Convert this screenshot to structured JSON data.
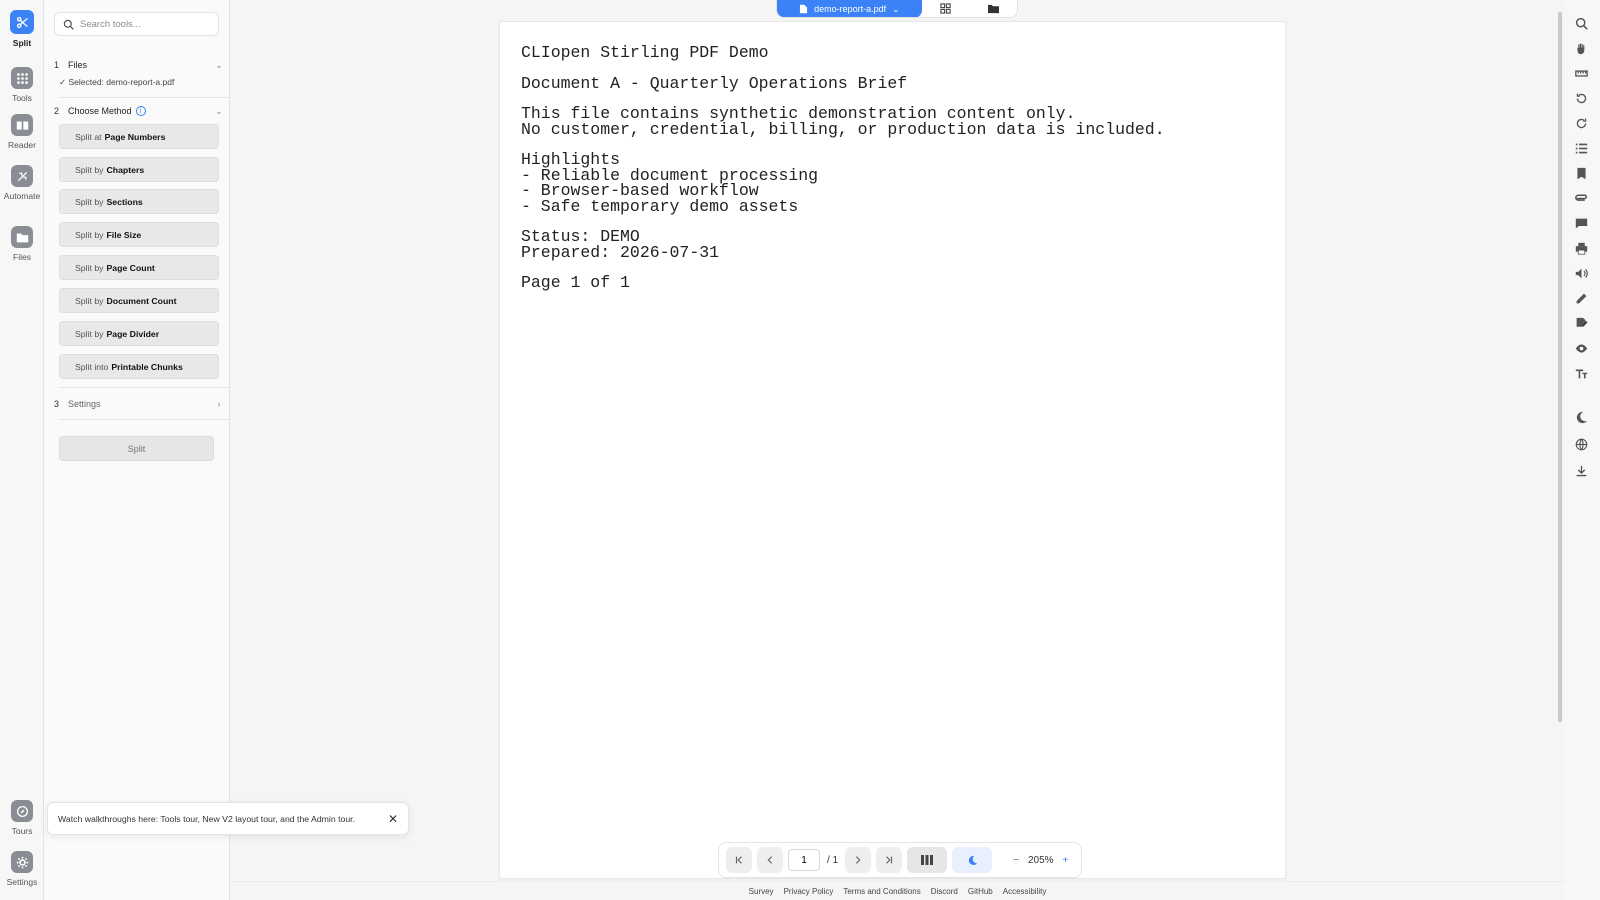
{
  "colors": {
    "accent": "#3b82f6",
    "icon_gray": "#8a8e94"
  },
  "left_rail": {
    "items": [
      {
        "label": "Split",
        "icon": "scissors-icon"
      },
      {
        "label": "Tools",
        "icon": "grid-icon"
      },
      {
        "label": "Reader",
        "icon": "book-icon"
      },
      {
        "label": "Automate",
        "icon": "automate-icon"
      },
      {
        "label": "Files",
        "icon": "folder-icon"
      },
      {
        "label": "Tours",
        "icon": "compass-icon"
      },
      {
        "label": "Settings",
        "icon": "gear-icon"
      }
    ]
  },
  "panel": {
    "search_placeholder": "Search tools...",
    "steps": [
      {
        "num": "1",
        "title": "Files"
      },
      {
        "num": "2",
        "title": "Choose Method"
      },
      {
        "num": "3",
        "title": "Settings"
      }
    ],
    "selected_file": "✓ Selected: demo-report-a.pdf",
    "methods": [
      {
        "prefix": "Split at",
        "bold": "Page Numbers"
      },
      {
        "prefix": "Split by",
        "bold": "Chapters"
      },
      {
        "prefix": "Split by",
        "bold": "Sections"
      },
      {
        "prefix": "Split by",
        "bold": "File Size"
      },
      {
        "prefix": "Split by",
        "bold": "Page Count"
      },
      {
        "prefix": "Split by",
        "bold": "Document Count"
      },
      {
        "prefix": "Split by",
        "bold": "Page Divider"
      },
      {
        "prefix": "Split into",
        "bold": "Printable Chunks"
      }
    ],
    "split_button": "Split"
  },
  "toast": {
    "text": "Watch walkthroughs here: Tools tour, New V2 layout tour, and the Admin tour.",
    "close": "✕"
  },
  "topbar": {
    "file_name": "demo-report-a.pdf"
  },
  "document": {
    "lines": [
      "CLIopen Stirling PDF Demo",
      "",
      "Document A - Quarterly Operations Brief",
      "",
      "This file contains synthetic demonstration content only.",
      "No customer, credential, billing, or production data is included.",
      "",
      "Highlights",
      "- Reliable document processing",
      "- Browser-based workflow",
      "- Safe temporary demo assets",
      "",
      "Status: DEMO",
      "Prepared: 2026-07-31",
      "",
      "Page 1 of 1"
    ]
  },
  "navbar": {
    "page_value": "1",
    "page_total": "/ 1",
    "zoom": "205%",
    "zoom_minus": "−",
    "zoom_plus": "+"
  },
  "footer": {
    "links": [
      "Survey",
      "Privacy Policy",
      "Terms and Conditions",
      "Discord",
      "GitHub",
      "Accessibility"
    ]
  }
}
